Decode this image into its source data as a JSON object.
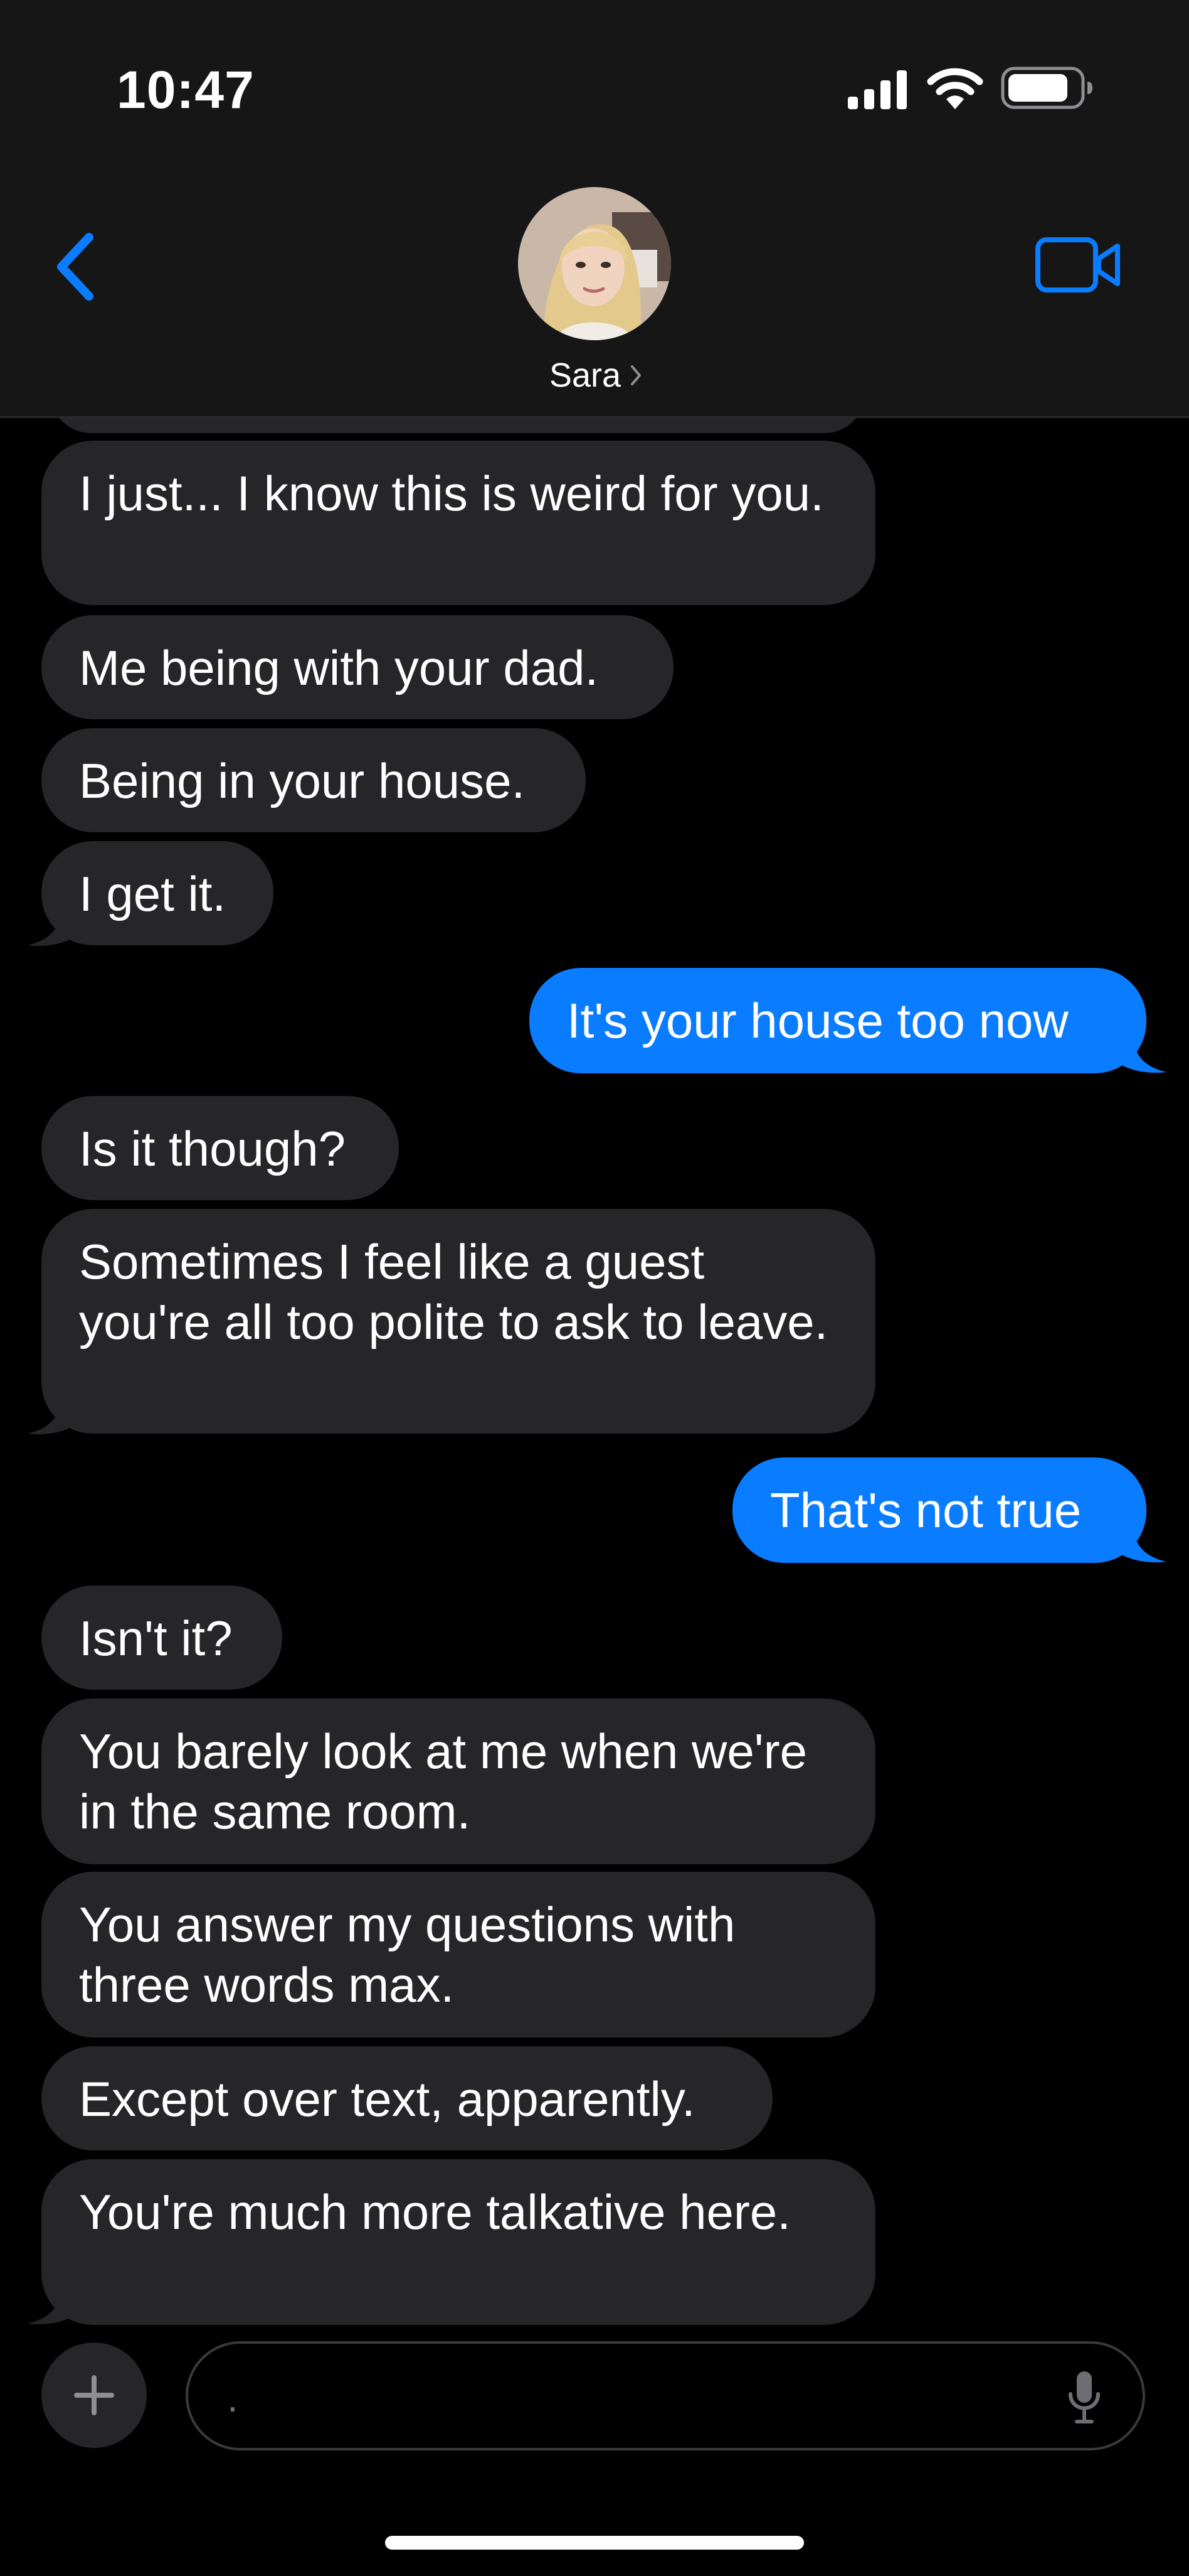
{
  "status_bar": {
    "time": "10:47",
    "icons": [
      "cellular-signal-icon",
      "wifi-icon",
      "battery-icon"
    ]
  },
  "header": {
    "back_icon": "chevron-left-icon",
    "contact_name": "Sara",
    "contact_chevron": "chevron-right-icon",
    "video_icon": "video-camera-icon"
  },
  "colors": {
    "accent": "#0a7cff",
    "incoming_bubble": "#262629",
    "header_bg": "#161616",
    "background": "#000000"
  },
  "messages": [
    {
      "direction": "incoming",
      "text": "I just... I know this is weird for you."
    },
    {
      "direction": "incoming",
      "text": "Me being with your dad."
    },
    {
      "direction": "incoming",
      "text": "Being in your house."
    },
    {
      "direction": "incoming",
      "text": "I get it."
    },
    {
      "direction": "outgoing",
      "text": "It's your house too now"
    },
    {
      "direction": "incoming",
      "text": "Is it though?"
    },
    {
      "direction": "incoming",
      "text": "Sometimes I feel like a guest you're all too polite to ask to leave."
    },
    {
      "direction": "outgoing",
      "text": "That's not true"
    },
    {
      "direction": "incoming",
      "text": "Isn't it?"
    },
    {
      "direction": "incoming",
      "text": "You barely look at me when we're in the same room."
    },
    {
      "direction": "incoming",
      "text": "You answer my questions with three words max."
    },
    {
      "direction": "incoming",
      "text": "Except over text, apparently."
    },
    {
      "direction": "incoming",
      "text": "You're much more talkative here."
    }
  ],
  "composer": {
    "plus_icon": "plus-icon",
    "placeholder": ".",
    "value": "",
    "mic_icon": "microphone-icon"
  }
}
